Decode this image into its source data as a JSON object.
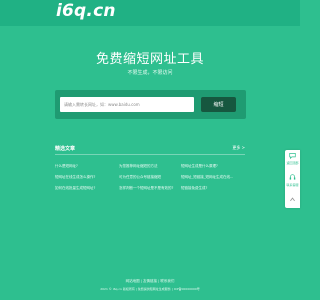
{
  "header": {
    "logo": "i6q.cn"
  },
  "hero": {
    "title": "免费缩短网址工具",
    "subtitle": "不限生成，不限访问"
  },
  "form": {
    "placeholder": "请输入需转长网址，如：www.baidu.com",
    "button_label": "缩短"
  },
  "articles": {
    "title": "精选文章",
    "more": "更多 >",
    "items": [
      "什么是短网址?",
      "短网址在线生成怎么操作?",
      "如何在线批量生成短网址?",
      "为您推荐网址缩短的方法",
      "可为任意的公众号链接缩短",
      "怎样判断一个短网址是不是有效的?",
      "短网址生成是什么原理?",
      "短网址_短链接_短网址生成在线...",
      "短链接免费生成?"
    ]
  },
  "side": {
    "items": [
      {
        "label": "返回顶部",
        "icon": "chat-icon"
      },
      {
        "label": "联系客服",
        "icon": "headset-icon"
      }
    ],
    "up_icon": "arrow-up-icon"
  },
  "footer": {
    "links": "网站地图 | 友情链接 | 联系我们",
    "copyright": "2021 © i6q.cn 版权所有 | 免费提供短网址生成服务 | ICP备00000000号"
  },
  "colors": {
    "background": "#2ebf8f",
    "topbar": "#20b184",
    "form_panel": "#1f9b72",
    "button": "#16573f"
  }
}
